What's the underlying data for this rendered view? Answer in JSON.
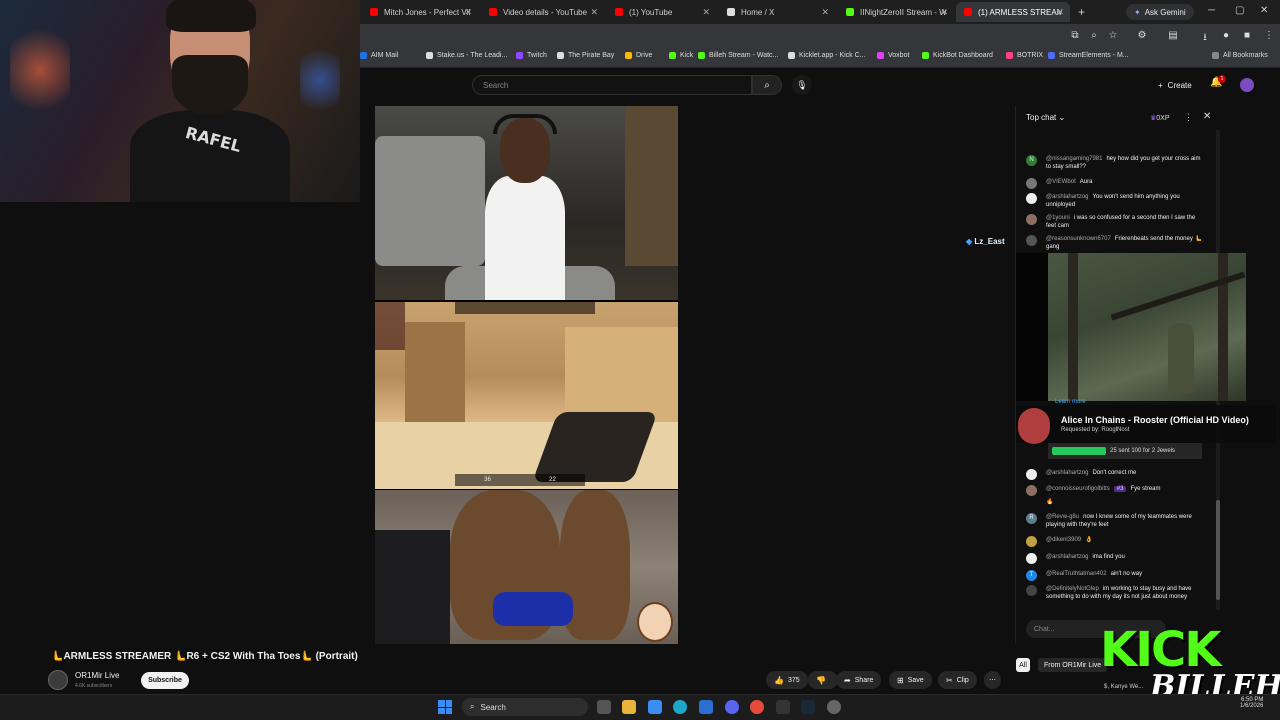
{
  "browser": {
    "tabs": [
      {
        "label": "Mitch Jones - Perfect Vil",
        "color": "#ff0000"
      },
      {
        "label": "Video details - YouTube",
        "color": "#ff0000"
      },
      {
        "label": "(1) YouTube",
        "color": "#ff0000"
      },
      {
        "label": "Home / X",
        "color": "#dddddd"
      },
      {
        "label": "IINightZeroII Stream - W",
        "color": "#53fc18"
      },
      {
        "label": "(1) ARMLESS STREAM",
        "color": "#ff0000"
      }
    ],
    "ask_gemini": "Ask Gemini",
    "bookmarks": [
      {
        "label": "AIM Mail",
        "color": "#1a73e8"
      },
      {
        "label": "Stake.us - The Leadi...",
        "color": "#dddddd"
      },
      {
        "label": "Twitch",
        "color": "#9146ff"
      },
      {
        "label": "The Pirate Bay",
        "color": "#dddddd"
      },
      {
        "label": "Drive",
        "color": "#fbbc04"
      },
      {
        "label": "Kick",
        "color": "#53fc18"
      },
      {
        "label": "Billeh Stream - Watc...",
        "color": "#53fc18"
      },
      {
        "label": "Kicklet.app - Kick C...",
        "color": "#dddddd"
      },
      {
        "label": "Voxbot",
        "color": "#e040fb"
      },
      {
        "label": "KickBot Dashboard",
        "color": "#53fc18"
      },
      {
        "label": "BOTRIX",
        "color": "#ff4081"
      },
      {
        "label": "StreamElements - M...",
        "color": "#4a6cf7"
      }
    ],
    "all_bookmarks": "All Bookmarks"
  },
  "youtube": {
    "search_placeholder": "Search",
    "create_label": "Create",
    "notif_count": "1"
  },
  "video": {
    "title": "🫷ARMLESS STREAMER 🫷R6 + CS2 With Tha Toes🫷 (Portrait)",
    "channel": "OR1Mir Live",
    "subscribers": "4.6K subscribers",
    "subscribe_label": "Subscribe",
    "likes": "375",
    "share_label": "Share",
    "save_label": "Save",
    "clip_label": "Clip",
    "hud_values": [
      "36",
      "22"
    ]
  },
  "chat": {
    "header": "Top chat",
    "xp": "0XP",
    "messages_top": [
      {
        "user": "@nissangaming7981",
        "text": "hey how did you get your cross aim to stay small??",
        "avatar": "N",
        "color": "#2e7d32"
      },
      {
        "user": "@VIEWbot",
        "text": "Aura",
        "avatar": "",
        "color": "#777777"
      },
      {
        "user": "@arshlahartzog",
        "text": "You won't send him anything you unniployed",
        "avatar": "",
        "color": "#eeeeee"
      },
      {
        "user": "@1youni",
        "text": "i was so confused for a second then I saw the feet cam",
        "avatar": "",
        "color": "#8d6e63"
      },
      {
        "user": "@reasonsunknown6707",
        "text": "Frierenbeats send the money 🫷 gang",
        "avatar": "",
        "color": "#555555"
      }
    ],
    "messages_bottom": [
      {
        "user": "@arshlahartzog",
        "text": "Don't correct me",
        "avatar": "",
        "color": "#eeeeee",
        "badge": ""
      },
      {
        "user": "@connoisseurofigolbitts",
        "text": "Fye stream",
        "avatar": "",
        "color": "#8d6e63",
        "badge": "#3"
      },
      {
        "user": "@Revw-g8u",
        "text": "now I knew some of my teammates were playing with they're feet",
        "avatar": "R",
        "color": "#607d8b",
        "badge": ""
      },
      {
        "user": "@dikenl3909",
        "text": "👌",
        "avatar": "",
        "color": "#c0a040",
        "badge": ""
      },
      {
        "user": "@arshlahartzog",
        "text": "ima find you",
        "avatar": "",
        "color": "#eeeeee",
        "badge": ""
      },
      {
        "user": "@RealTruthtatman402",
        "text": "ain't no way",
        "avatar": "T",
        "color": "#1e88e5",
        "badge": ""
      },
      {
        "user": "@DefinitelyNotGlep",
        "text": "im working to stay busy and have something to do with my day its not just about money",
        "avatar": "",
        "color": "#444444",
        "badge": ""
      }
    ],
    "fire": "🔥",
    "input_placeholder": "Chat...",
    "jewels_text": "25 sent 100 for 2 Jewels",
    "filter_all": "All",
    "filter_from": "From OR1Mir Live"
  },
  "overlay": {
    "streamer_tag": "Lz_East",
    "song_title": "Alice In Chains - Rooster (Official HD Video)",
    "song_requested": "Requested by: RooglNost",
    "learn_more": "Learn more",
    "kick_text": "KICK",
    "billeh_text": "BILLEH",
    "kanye": "$, Kanye We..."
  },
  "webcam": {
    "shirt_text": "RAFEL"
  },
  "taskbar": {
    "search": "Search",
    "time": "6:50 PM",
    "date": "1/6/2026"
  }
}
